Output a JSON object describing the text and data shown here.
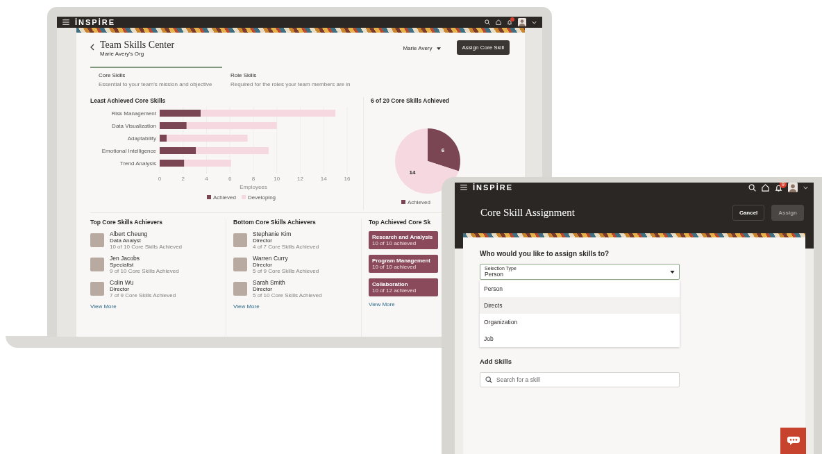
{
  "laptop": {
    "app_bar": {
      "logo": "İNSPİRE"
    },
    "header": {
      "title": "Team Skills Center",
      "subtitle": "Marie Avery's Org",
      "person_menu": "Marie Avery",
      "primary_button": "Assign Core Skill"
    },
    "tabs": [
      {
        "label": "Core Skills",
        "description": "Essential to your team's mission and objective",
        "selected": true
      },
      {
        "label": "Role Skills",
        "description": "Required for the roles your team members are in",
        "selected": false
      }
    ],
    "bar_panel": {
      "chart_data": {
        "type": "bar",
        "orientation": "horizontal",
        "stacked": true,
        "grid": true,
        "legend": true,
        "title": "Least Achieved Core Skills",
        "xlabel": "Employees",
        "categories": [
          "Risk Management",
          "Data Visualization",
          "Adaptability",
          "Emotional Intelligence",
          "Trend Analysis"
        ],
        "xlim": [
          0,
          16
        ],
        "xticks": [
          0,
          2,
          4,
          6,
          8,
          10,
          12,
          14,
          16
        ],
        "series": [
          {
            "name": "Achieved",
            "color": "#7b4654",
            "values": [
              3.5,
              2.3,
              0.6,
              3.1,
              2.1
            ]
          },
          {
            "name": "Developing",
            "color": "#f6d9e0",
            "values": [
              11.5,
              7.7,
              6.9,
              6.2,
              4
            ]
          }
        ]
      }
    },
    "pie_panel": {
      "chart_data": {
        "type": "pie",
        "title": "6 of 20 Core Skills Achieved",
        "values": [
          6,
          14
        ],
        "data_labels": true
      },
      "legend": [
        "Achieved"
      ]
    },
    "achiever_columns": [
      {
        "title": "Top Core Skills Achievers",
        "people": [
          {
            "name": "Albert Cheung",
            "role": "Data Analyst",
            "progress": "10 of 10 Core Skills Achieved"
          },
          {
            "name": "Jen Jacobs",
            "role": "Specialist",
            "progress": "9 of 10 Core Skills Achieved"
          },
          {
            "name": "Colin Wu",
            "role": "Director",
            "progress": "7 of 9 Core Skills Achieved"
          }
        ],
        "link": "View More"
      },
      {
        "title": "Bottom Core Skills Achievers",
        "people": [
          {
            "name": "Stephanie Kim",
            "role": "Director",
            "progress": "4 of 7 Core Skills Achieved"
          },
          {
            "name": "Warren Curry",
            "role": "Director",
            "progress": "5 of 9 Core Skills Achieved"
          },
          {
            "name": "Sarah Smith",
            "role": "Director",
            "progress": "5 of 10 Core Skills Achieved"
          }
        ],
        "link": "View More"
      }
    ],
    "skills_column": {
      "title": "Top Achieved Core Sk",
      "skills": [
        {
          "name": "Research and Analysis",
          "progress": "10 of 10 achieved"
        },
        {
          "name": "Program Management",
          "progress": "10 of 10 achieved"
        },
        {
          "name": "Collaboration",
          "progress": "10 of 12 achieved"
        }
      ],
      "link": "View More"
    }
  },
  "tablet": {
    "app_bar": {
      "logo": "İNSPİRE",
      "notification_count": "9"
    },
    "title": "Core Skill Assignment",
    "buttons": [
      {
        "label": "Cancel",
        "disabled": false
      },
      {
        "label": "Assign",
        "disabled": true
      }
    ],
    "question": "Who would you like to assign skills to?",
    "selection_field": {
      "label": "Selection Type",
      "value": "Person",
      "options": [
        {
          "label": "Person",
          "highlighted": false
        },
        {
          "label": "Directs",
          "highlighted": true
        },
        {
          "label": "Organization",
          "highlighted": false
        },
        {
          "label": "Job",
          "highlighted": false
        }
      ]
    },
    "add_skills": {
      "heading": "Add Skills",
      "placeholder": "Search for a skill"
    }
  }
}
